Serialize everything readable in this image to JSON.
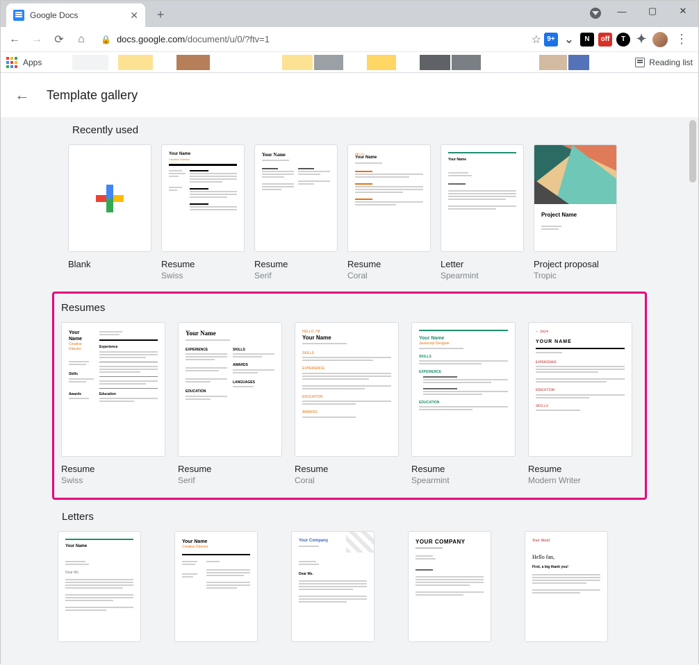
{
  "browser": {
    "tab_title": "Google Docs",
    "url_host": "docs.google.com",
    "url_path": "/document/u/0/?ftv=1",
    "apps_label": "Apps",
    "reading_list_label": "Reading list"
  },
  "header": {
    "title": "Template gallery"
  },
  "sections": {
    "recent": {
      "title": "Recently used",
      "items": [
        {
          "name": "Blank",
          "sub": ""
        },
        {
          "name": "Resume",
          "sub": "Swiss"
        },
        {
          "name": "Resume",
          "sub": "Serif"
        },
        {
          "name": "Resume",
          "sub": "Coral"
        },
        {
          "name": "Letter",
          "sub": "Spearmint"
        },
        {
          "name": "Project proposal",
          "sub": "Tropic"
        }
      ]
    },
    "resumes": {
      "title": "Resumes",
      "items": [
        {
          "name": "Resume",
          "sub": "Swiss"
        },
        {
          "name": "Resume",
          "sub": "Serif"
        },
        {
          "name": "Resume",
          "sub": "Coral"
        },
        {
          "name": "Resume",
          "sub": "Spearmint"
        },
        {
          "name": "Resume",
          "sub": "Modern Writer"
        }
      ]
    },
    "letters": {
      "title": "Letters"
    }
  },
  "thumbs": {
    "swiss_name": "Your Name",
    "swiss_role": "Creative Director",
    "serif_name": "Your Name",
    "coral_name": "Your Name",
    "spearmint_name": "Your Name",
    "project_name": "Project Name",
    "letter_spear_from": "Your Name",
    "letter_company": "Your Company",
    "letter_bigcomp": "YOUR COMPANY",
    "letter_hello": "Hello fan,",
    "letter_dear": "Dear Ms.",
    "letter_thanks": "First, a big thank you!"
  }
}
